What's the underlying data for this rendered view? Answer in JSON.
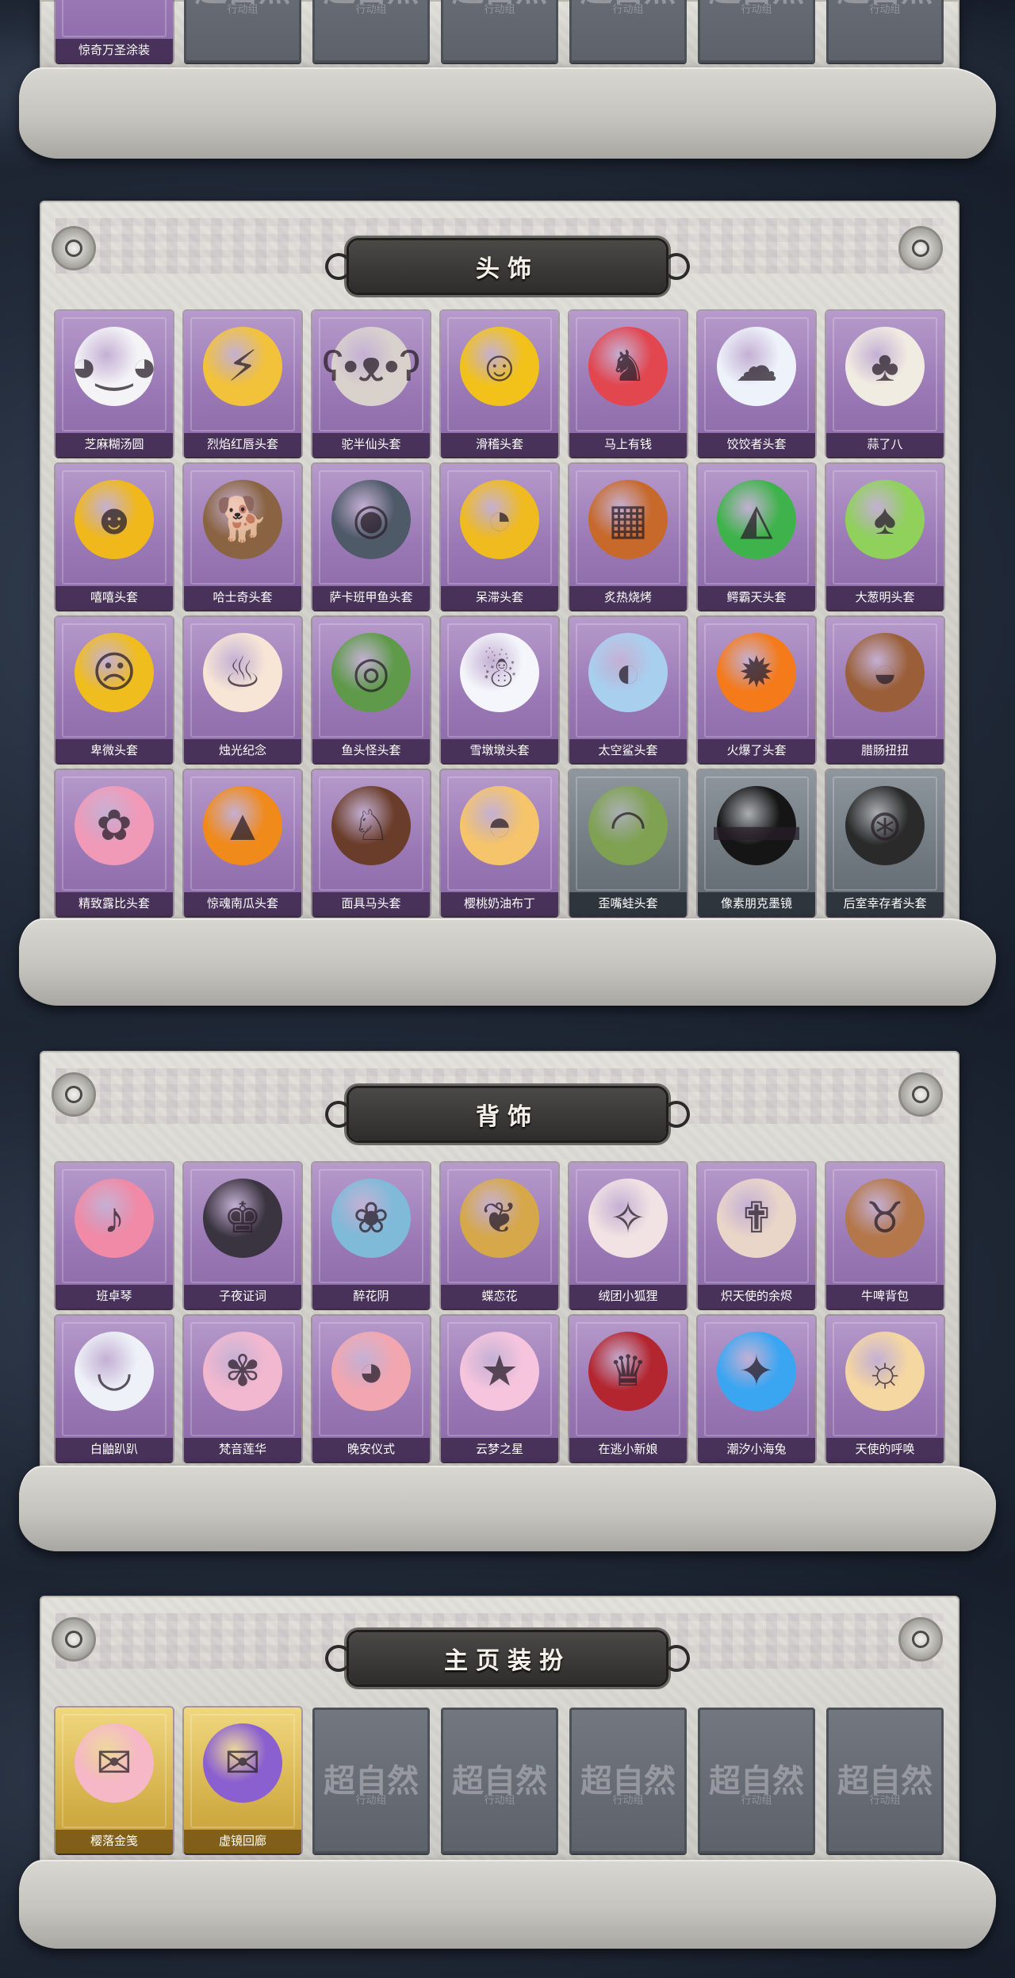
{
  "colors": {
    "purple_card": "#9a78b5",
    "gray_card": "#6f777f",
    "gold_card": "#d8b650",
    "panel": "#d6d4ce",
    "banner": "#3a3936"
  },
  "top": {
    "items": [
      {
        "label": "惊奇万圣涂装",
        "style": "purple",
        "icon": "car-icon"
      },
      {
        "label": "",
        "style": "placeholder",
        "icon": "watermark-logo"
      },
      {
        "label": "",
        "style": "placeholder",
        "icon": "watermark-logo"
      },
      {
        "label": "",
        "style": "placeholder",
        "icon": "watermark-logo"
      },
      {
        "label": "",
        "style": "placeholder",
        "icon": "watermark-logo"
      },
      {
        "label": "",
        "style": "placeholder",
        "icon": "watermark-logo"
      },
      {
        "label": "",
        "style": "placeholder",
        "icon": "watermark-logo"
      }
    ]
  },
  "watermark": {
    "main": "超自然",
    "sub": "行动组"
  },
  "sections": [
    {
      "title": "头饰",
      "items": [
        {
          "label": "芝麻糊汤圆",
          "style": "purple",
          "icon": "dumpling-icon",
          "glyph": "◕‿◕",
          "color": "#f4f4f7"
        },
        {
          "label": "烈焰红唇头套",
          "style": "purple",
          "icon": "pikachu-head-icon",
          "glyph": "⚡",
          "color": "#f2c23a"
        },
        {
          "label": "驼半仙头套",
          "style": "purple",
          "icon": "bear-head-icon",
          "glyph": "ʕ•ᴥ•ʔ",
          "color": "#d9d2cc"
        },
        {
          "label": "滑稽头套",
          "style": "purple",
          "icon": "smirk-face-icon",
          "glyph": "☺",
          "color": "#f2c21a"
        },
        {
          "label": "马上有钱",
          "style": "purple",
          "icon": "red-horse-icon",
          "glyph": "♞",
          "color": "#e2464f"
        },
        {
          "label": "饺饺者头套",
          "style": "purple",
          "icon": "cloud-head-icon",
          "glyph": "☁",
          "color": "#eef3fb"
        },
        {
          "label": "蒜了八",
          "style": "purple",
          "icon": "garlic-head-icon",
          "glyph": "♣",
          "color": "#f1ece2"
        },
        {
          "label": "嘻嘻头套",
          "style": "purple",
          "icon": "grin-face-icon",
          "glyph": "☻",
          "color": "#f0b81a"
        },
        {
          "label": "哈士奇头套",
          "style": "purple",
          "icon": "husky-head-icon",
          "glyph": "🐕",
          "color": "#8a6442"
        },
        {
          "label": "萨卡班甲鱼头套",
          "style": "purple",
          "icon": "fish-head-icon",
          "glyph": "◉",
          "color": "#4f5a69"
        },
        {
          "label": "呆滞头套",
          "style": "purple",
          "icon": "dazed-face-icon",
          "glyph": "◔",
          "color": "#f0bb1e"
        },
        {
          "label": "炙热烧烤",
          "style": "purple",
          "icon": "bbq-head-icon",
          "glyph": "▦",
          "color": "#c7692b"
        },
        {
          "label": "鳄霸天头套",
          "style": "purple",
          "icon": "crocodile-head-icon",
          "glyph": "◭",
          "color": "#3fb34b"
        },
        {
          "label": "大葱明头套",
          "style": "purple",
          "icon": "leek-head-icon",
          "glyph": "♠",
          "color": "#8fd15a"
        },
        {
          "label": "卑微头套",
          "style": "purple",
          "icon": "humble-face-icon",
          "glyph": "☹",
          "color": "#f0bd1e"
        },
        {
          "label": "烛光纪念",
          "style": "purple",
          "icon": "candle-head-icon",
          "glyph": "♨",
          "color": "#f7e6d6"
        },
        {
          "label": "鱼头怪头套",
          "style": "purple",
          "icon": "fish-monster-icon",
          "glyph": "◎",
          "color": "#5e9a4a"
        },
        {
          "label": "雪墩墩头套",
          "style": "purple",
          "icon": "snowman-head-icon",
          "glyph": "☃",
          "color": "#f4f6fb"
        },
        {
          "label": "太空鲨头套",
          "style": "purple",
          "icon": "shark-head-icon",
          "glyph": "◐",
          "color": "#a9cfee"
        },
        {
          "label": "火爆了头套",
          "style": "purple",
          "icon": "flame-head-icon",
          "glyph": "✹",
          "color": "#f47a1a"
        },
        {
          "label": "腊肠扭扭",
          "style": "purple",
          "icon": "dachshund-head-icon",
          "glyph": "◒",
          "color": "#9a5f38"
        },
        {
          "label": "精致露比头套",
          "style": "purple",
          "icon": "loopy-head-icon",
          "glyph": "✿",
          "color": "#f09ab8"
        },
        {
          "label": "惊魂南瓜头套",
          "style": "purple",
          "icon": "pumpkin-head-icon",
          "glyph": "▲",
          "color": "#f08a1a"
        },
        {
          "label": "面具马头套",
          "style": "purple",
          "icon": "horse-mask-icon",
          "glyph": "♘",
          "color": "#6a3d2a"
        },
        {
          "label": "樱桃奶油布丁",
          "style": "purple",
          "icon": "pudding-head-icon",
          "glyph": "◓",
          "color": "#f5c46b"
        },
        {
          "label": "歪嘴蛙头套",
          "style": "gray",
          "icon": "frog-head-icon",
          "glyph": "◠",
          "color": "#7fa152"
        },
        {
          "label": "像素朋克墨镜",
          "style": "gray",
          "icon": "pixel-sunglasses-icon",
          "glyph": "▬▬",
          "color": "#151515"
        },
        {
          "label": "后室幸存者头套",
          "style": "gray",
          "icon": "gas-mask-icon",
          "glyph": "⊛",
          "color": "#2a2a2a"
        }
      ]
    },
    {
      "title": "背饰",
      "items": [
        {
          "label": "班卓琴",
          "style": "purple",
          "icon": "banjo-beaver-icon",
          "glyph": "♪",
          "color": "#f08aa6"
        },
        {
          "label": "子夜证词",
          "style": "purple",
          "icon": "plague-doctor-icon",
          "glyph": "♚",
          "color": "#3a3340"
        },
        {
          "label": "醉花阴",
          "style": "purple",
          "icon": "flower-ornament-icon",
          "glyph": "❀",
          "color": "#7fbad8"
        },
        {
          "label": "蝶恋花",
          "style": "purple",
          "icon": "butterfly-ornament-icon",
          "glyph": "❦",
          "color": "#d6a84a"
        },
        {
          "label": "绒团小狐狸",
          "style": "purple",
          "icon": "fox-icon",
          "glyph": "✧",
          "color": "#f1e3e3"
        },
        {
          "label": "炽天使的余烬",
          "style": "purple",
          "icon": "angel-doll-icon",
          "glyph": "✟",
          "color": "#e9d6c9"
        },
        {
          "label": "牛啤背包",
          "style": "purple",
          "icon": "beer-cow-icon",
          "glyph": "♉",
          "color": "#b4774a"
        },
        {
          "label": "白鼬趴趴",
          "style": "purple",
          "icon": "ermine-icon",
          "glyph": "◡",
          "color": "#eef2f8"
        },
        {
          "label": "梵音莲华",
          "style": "purple",
          "icon": "lotus-doll-icon",
          "glyph": "✾",
          "color": "#f2b8cf"
        },
        {
          "label": "晚安仪式",
          "style": "purple",
          "icon": "pig-doll-icon",
          "glyph": "◕",
          "color": "#f2a7b0"
        },
        {
          "label": "云梦之星",
          "style": "purple",
          "icon": "unicorn-cloud-icon",
          "glyph": "★",
          "color": "#f6c5dd"
        },
        {
          "label": "在逃小新娘",
          "style": "purple",
          "icon": "bride-doll-icon",
          "glyph": "♛",
          "color": "#b3262f"
        },
        {
          "label": "潮汐小海兔",
          "style": "purple",
          "icon": "sea-bunny-icon",
          "glyph": "✦",
          "color": "#3aa6f2"
        },
        {
          "label": "天使的呼唤",
          "style": "purple",
          "icon": "cherub-icon",
          "glyph": "☼",
          "color": "#f5d7a2"
        }
      ]
    },
    {
      "title": "主页装扮",
      "items": [
        {
          "label": "樱落金笺",
          "style": "gold",
          "icon": "pink-card-icon",
          "glyph": "✉",
          "color": "#f6b7c6"
        },
        {
          "label": "虚镜回廊",
          "style": "gold",
          "icon": "purple-card-icon",
          "glyph": "✉",
          "color": "#8a5fd0"
        },
        {
          "label": "",
          "style": "placeholder",
          "icon": "watermark-logo"
        },
        {
          "label": "",
          "style": "placeholder",
          "icon": "watermark-logo"
        },
        {
          "label": "",
          "style": "placeholder",
          "icon": "watermark-logo"
        },
        {
          "label": "",
          "style": "placeholder",
          "icon": "watermark-logo"
        },
        {
          "label": "",
          "style": "placeholder",
          "icon": "watermark-logo"
        }
      ]
    }
  ]
}
